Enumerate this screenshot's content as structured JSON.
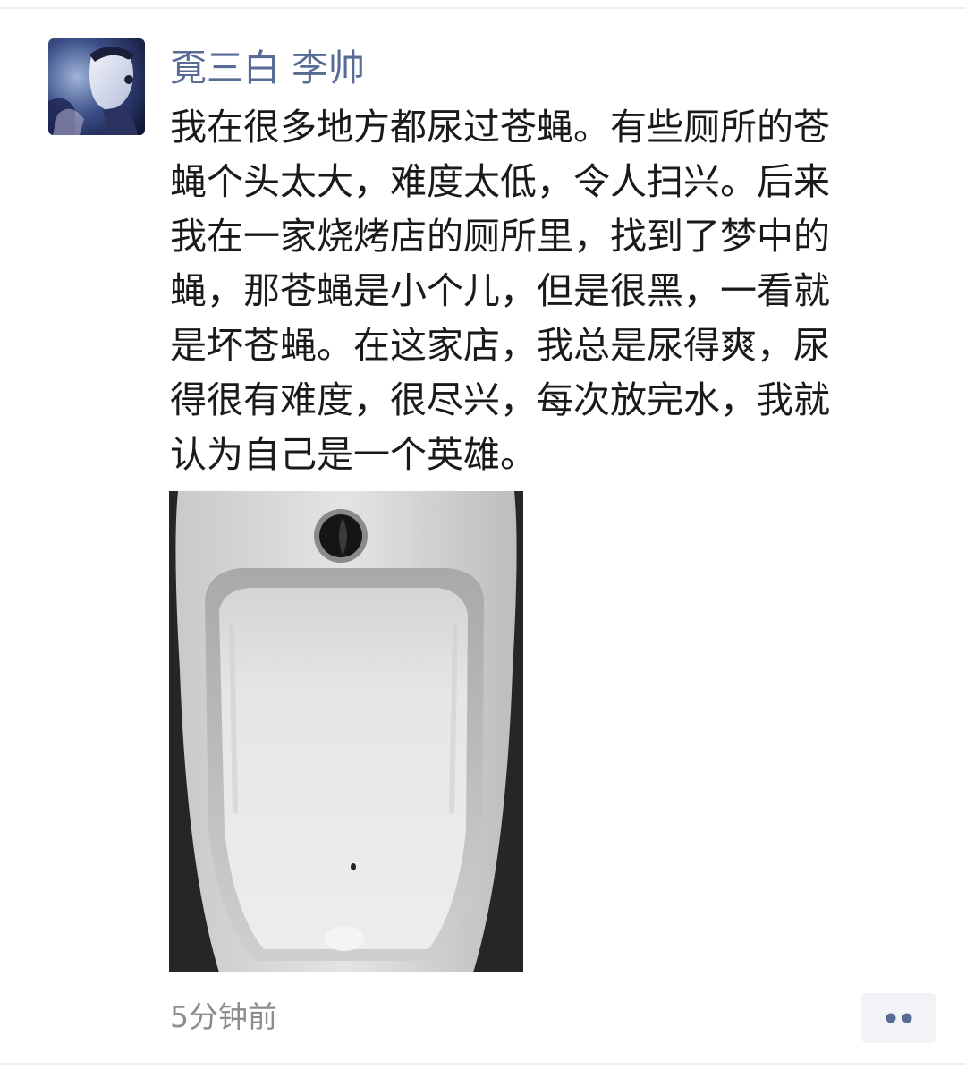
{
  "post": {
    "author_name": "覔三白 李帅",
    "avatar_icon": "user-avatar-photo",
    "text_lines": [
      "我在很多地方都尿过苍蝇。有些厕所的苍",
      "蝇个头太大，难度太低，令人扫兴。后来",
      "我在一家烧烤店的厕所里，找到了梦中的",
      "蝇，那苍蝇是小个儿，但是很黑，一看就",
      "是坏苍蝇。在这家店，我总是尿得爽，尿",
      "得很有难度，很尽兴，每次放完水，我就",
      "认为自己是一个英雄。"
    ],
    "image_icon": "urinal-photo",
    "time": "5分钟前",
    "more_icon": "more-dots-icon"
  },
  "colors": {
    "author": "#576b95",
    "body_text": "#1a1a1a",
    "time": "#8c8c8c",
    "more_button_bg": "#f2f3f7",
    "more_dots": "#576b95"
  }
}
